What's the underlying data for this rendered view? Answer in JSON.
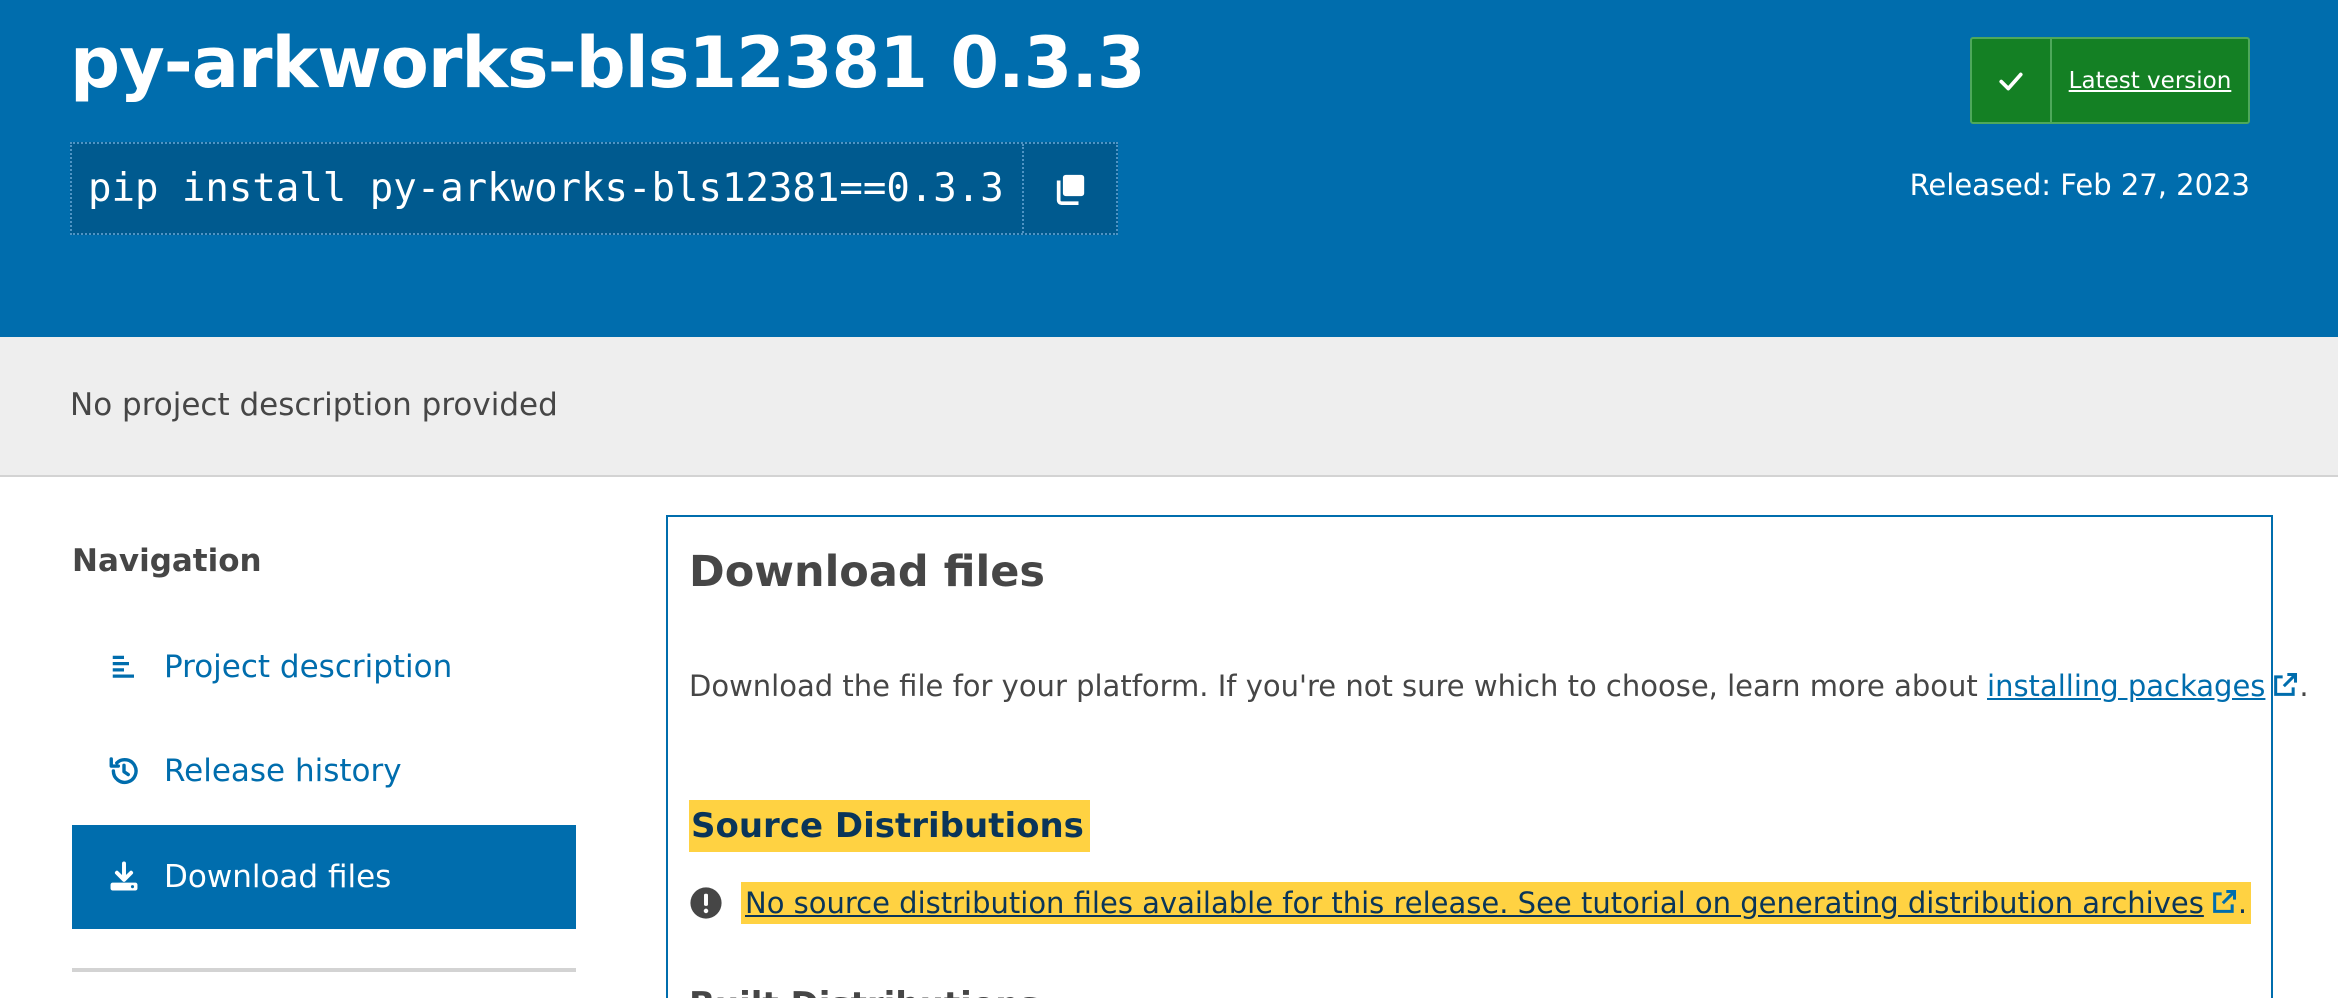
{
  "header": {
    "title": "py-arkworks-bls12381 0.3.3",
    "pip_command": "pip install py-arkworks-bls12381==0.3.3",
    "latest_version_label": "Latest version",
    "released": "Released: Feb 27, 2023"
  },
  "description": {
    "text": "No project description provided"
  },
  "sidebar": {
    "heading": "Navigation",
    "items": [
      {
        "label": "Project description",
        "icon": "align-left-icon",
        "active": false
      },
      {
        "label": "Release history",
        "icon": "history-icon",
        "active": false
      },
      {
        "label": "Download files",
        "icon": "download-icon",
        "active": true
      }
    ]
  },
  "main": {
    "title": "Download files",
    "intro_prefix": "Download the file for your platform. If you're not sure which to choose, learn more about ",
    "intro_link": "installing packages",
    "intro_suffix": ".",
    "source_heading": "Source Distributions",
    "notice_text": "No source distribution files available for this release. See tutorial on generating distribution archives",
    "notice_suffix": ".",
    "built_heading": "Built Distributions"
  },
  "colors": {
    "brand_blue": "#006dad",
    "success_green": "#148024",
    "highlight_yellow": "#ffd242",
    "strip_gray": "#eeeeee"
  }
}
